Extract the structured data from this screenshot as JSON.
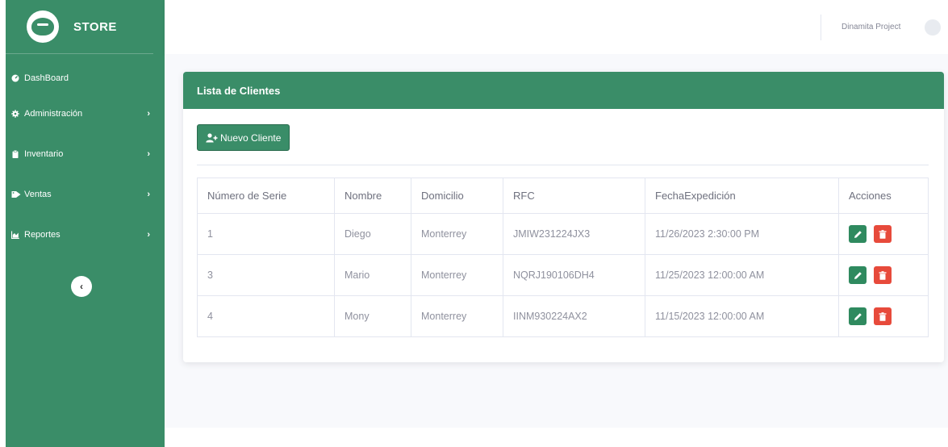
{
  "sidebar": {
    "brand": "STORE",
    "items": [
      {
        "label": "DashBoard",
        "icon": "dashboard-icon",
        "has_chevron": false
      },
      {
        "label": "Administración",
        "icon": "gear-icon",
        "has_chevron": true
      },
      {
        "label": "Inventario",
        "icon": "clipboard-icon",
        "has_chevron": true
      },
      {
        "label": "Ventas",
        "icon": "tag-icon",
        "has_chevron": true
      },
      {
        "label": "Reportes",
        "icon": "chart-area-icon",
        "has_chevron": true
      }
    ],
    "chevron": "›",
    "collapse_glyph": "‹"
  },
  "topbar": {
    "user_name": "Dinamita Project"
  },
  "card": {
    "title": "Lista de Clientes",
    "new_button_label": "Nuevo Cliente"
  },
  "table": {
    "headers": [
      "Número de Serie",
      "Nombre",
      "Domicilio",
      "RFC",
      "FechaExpedición",
      "Acciones"
    ],
    "rows": [
      [
        "1",
        "Diego",
        "Monterrey",
        "JMIW231224JX3",
        "11/26/2023 2:30:00 PM"
      ],
      [
        "3",
        "Mario",
        "Monterrey",
        "NQRJ190106DH4",
        "11/25/2023 12:00:00 AM"
      ],
      [
        "4",
        "Mony",
        "Monterrey",
        "IINM930224AX2",
        "11/15/2023 12:00:00 AM"
      ]
    ]
  },
  "colors": {
    "primary": "#3a8d68",
    "danger": "#e74a3b"
  }
}
